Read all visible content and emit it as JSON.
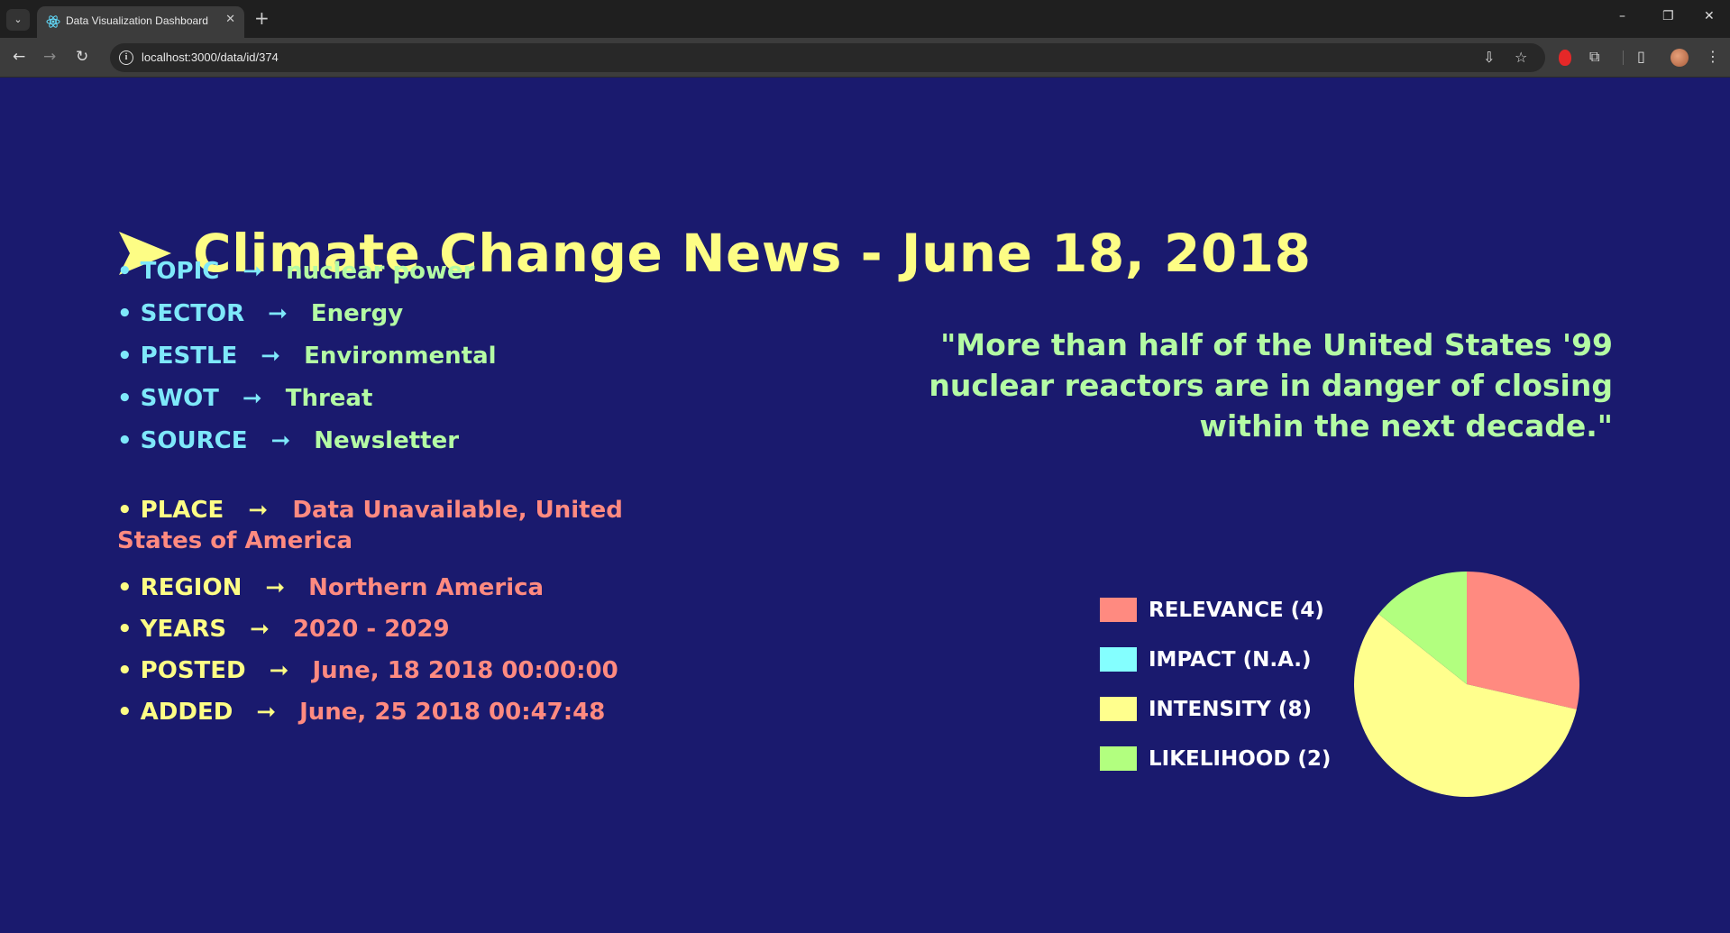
{
  "browser": {
    "tab_title": "Data Visualization Dashboard",
    "url": "localhost:3000/data/id/374"
  },
  "page": {
    "title": "Climate Change News - June 18, 2018",
    "quote": "\"More than half of the United States '99 nuclear reactors are in danger of closing within the next decade.\"",
    "arrow_glyph": "➞",
    "details": [
      {
        "key": "• TOPIC",
        "value": "nuclear power"
      },
      {
        "key": "• SECTOR",
        "value": "Energy"
      },
      {
        "key": "• PESTLE",
        "value": "Environmental"
      },
      {
        "key": "• SWOT",
        "value": "Threat"
      },
      {
        "key": "• SOURCE",
        "value": "Newsletter"
      }
    ],
    "place": {
      "key": "• PLACE",
      "value": "Data Unavailable, United States of America"
    },
    "meta": [
      {
        "key": "• REGION",
        "value": "Northern America"
      },
      {
        "key": "• YEARS",
        "value": "2020 - 2029"
      },
      {
        "key": "• POSTED",
        "value": "June, 18 2018 00:00:00"
      },
      {
        "key": "• ADDED",
        "value": "June, 25 2018 00:47:48"
      }
    ]
  },
  "colors": {
    "background": "#1a1a6e",
    "title": "#fdfd85",
    "relevance": "#ff8a80",
    "impact": "#84ffff",
    "intensity": "#ffff8d",
    "likelihood": "#b9f6ca"
  },
  "chart_data": {
    "type": "pie",
    "legend_position": "left",
    "slices": [
      {
        "label": "RELEVANCE (4)",
        "value": 4,
        "color": "#ff8a80"
      },
      {
        "label": "IMPACT (N.A.)",
        "value": 0,
        "color": "#84ffff"
      },
      {
        "label": "INTENSITY (8)",
        "value": 8,
        "color": "#ffff8d"
      },
      {
        "label": "LIKELIHOOD (2)",
        "value": 2,
        "color": "#b2ff7f"
      }
    ]
  }
}
